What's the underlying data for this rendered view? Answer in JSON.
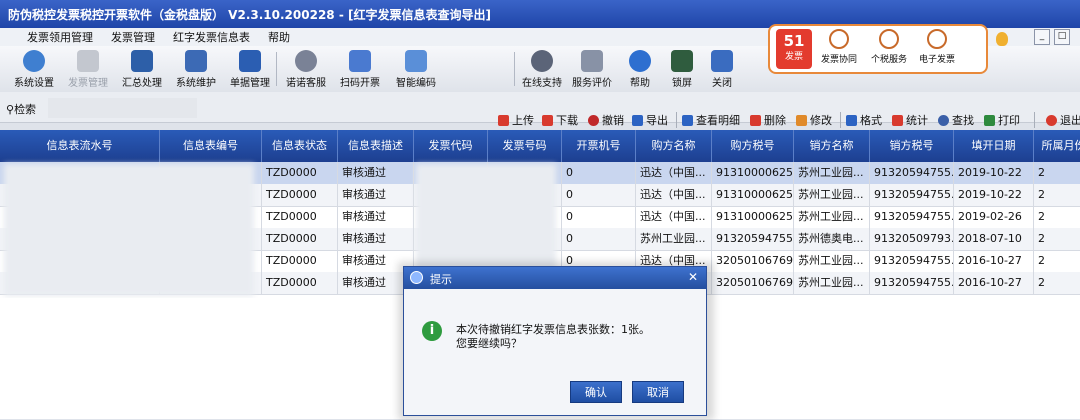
{
  "window": {
    "title": "防伪税控发票税控开票软件（金税盘版） V2.3.10.200228 - [红字发票信息表查询导出]"
  },
  "menu": {
    "items": [
      "发票领用管理",
      "发票管理",
      "红字发票信息表",
      "帮助"
    ]
  },
  "toolbar": {
    "buttons": [
      "系统设置",
      "发票管理",
      "汇总处理",
      "系统维护",
      "单据管理",
      "诺诺客服",
      "扫码开票",
      "智能编码",
      "在线支持",
      "服务评价",
      "帮助",
      "锁屏",
      "关闭"
    ]
  },
  "services": {
    "badge_number": "51",
    "badge_label": "发票",
    "items": [
      "发票协同",
      "个税服务",
      "电子发票"
    ]
  },
  "search": {
    "label": "检索",
    "value": ""
  },
  "actions": [
    "上传",
    "下载",
    "撤销",
    "导出",
    "查看明细",
    "删除",
    "修改",
    "格式",
    "统计",
    "查找",
    "打印",
    "退出"
  ],
  "table": {
    "columns": [
      "信息表流水号",
      "信息表编号",
      "信息表状态",
      "信息表描述",
      "发票代码",
      "发票号码",
      "开票机号",
      "购方名称",
      "购方税号",
      "销方名称",
      "销方税号",
      "填开日期",
      "所属月份"
    ],
    "rows": [
      [
        "",
        "",
        "TZD0000",
        "审核通过",
        "",
        "",
        "0",
        "迅达（中国...",
        "91310000625...",
        "苏州工业园...",
        "91320594755...",
        "2019-10-22",
        "2"
      ],
      [
        "",
        "",
        "TZD0000",
        "审核通过",
        "",
        "",
        "0",
        "迅达（中国...",
        "91310000625...",
        "苏州工业园...",
        "91320594755...",
        "2019-10-22",
        "2"
      ],
      [
        "",
        "",
        "TZD0000",
        "审核通过",
        "",
        "",
        "0",
        "迅达（中国...",
        "91310000625...",
        "苏州工业园...",
        "91320594755...",
        "2019-02-26",
        "2"
      ],
      [
        "",
        "",
        "TZD0000",
        "审核通过",
        "",
        "",
        "0",
        "苏州工业园...",
        "91320594755...",
        "苏州德奥电...",
        "91320509793...",
        "2018-07-10",
        "2"
      ],
      [
        "",
        "",
        "TZD0000",
        "审核通过",
        "",
        "",
        "0",
        "迅达（中国...",
        "32050106769...",
        "苏州工业园...",
        "91320594755...",
        "2016-10-27",
        "2"
      ],
      [
        "",
        "",
        "TZD0000",
        "审核通过",
        "",
        "",
        "0",
        "迅达（中国...",
        "32050106769...",
        "苏州工业园...",
        "91320594755...",
        "2016-10-27",
        "2"
      ]
    ]
  },
  "dialog": {
    "title": "提示",
    "message_line1": "本次待撤销红字发票信息表张数：1张。",
    "message_line2": "您要继续吗？",
    "confirm_label": "确认",
    "cancel_label": "取消"
  },
  "colors": {
    "title_bar": "#1f45a8",
    "grid_header": "#2a5bb8",
    "service_border": "#e8893a",
    "badge_red": "#e33b2e",
    "info_green": "#2e9b3f"
  }
}
